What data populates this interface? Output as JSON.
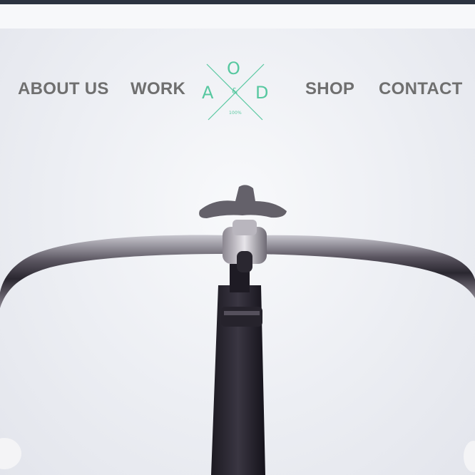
{
  "nav": {
    "left": [
      {
        "label": "ABOUT US"
      },
      {
        "label": "WORK"
      }
    ],
    "right": [
      {
        "label": "SHOP"
      },
      {
        "label": "CONTACT"
      }
    ]
  },
  "logo": {
    "top_letter": "O",
    "left_letter": "A",
    "right_letter": "D",
    "ampersand": "&",
    "tagline": "100%",
    "color": "#57c8a0"
  },
  "colors": {
    "top_bar": "#2c3340",
    "nav_text": "#6f6f6f",
    "background": "#eef0f4"
  }
}
